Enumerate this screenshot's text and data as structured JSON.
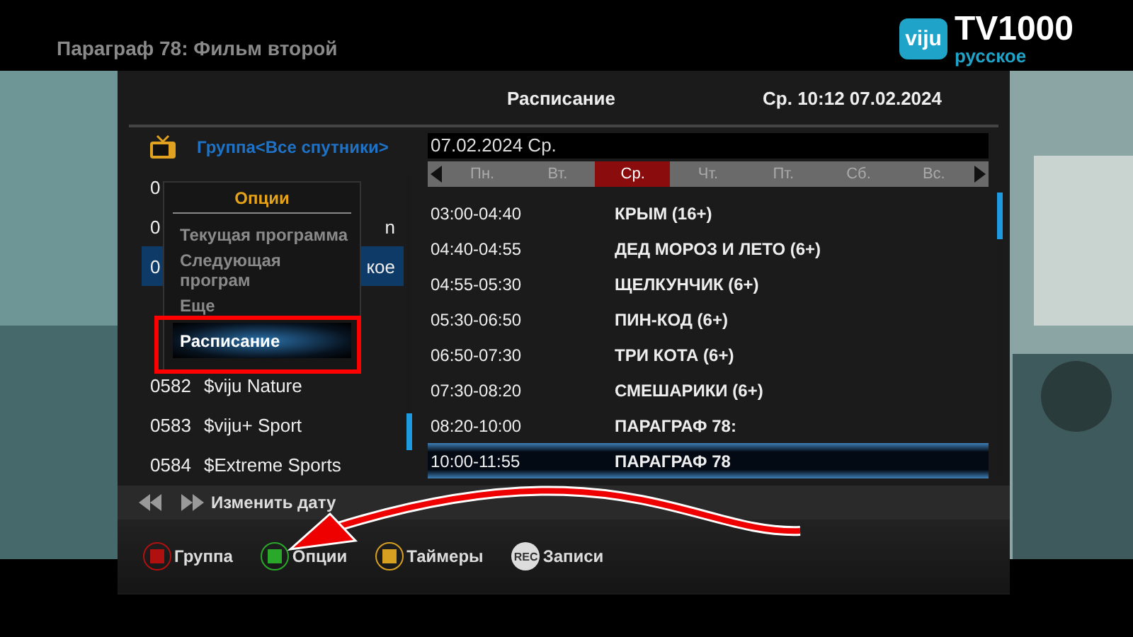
{
  "top_bar": {
    "title": "Параграф 78: Фильм второй",
    "logo": {
      "badge": "viju",
      "name": "TV1000",
      "sub": "русское"
    }
  },
  "header": {
    "title": "Расписание",
    "clock": "Ср. 10:12 07.02.2024"
  },
  "channels": {
    "group": "Группа<Все спутники>",
    "rows": [
      {
        "kind": "covered",
        "number": "0",
        "selected": false
      },
      {
        "kind": "covered",
        "number": "0",
        "tail": "n",
        "selected": false
      },
      {
        "kind": "covered",
        "number": "0",
        "tail": "кое",
        "selected": true
      },
      {
        "kind": "full",
        "number": "0582",
        "name": "$viju Nature",
        "selected": false
      },
      {
        "kind": "full",
        "number": "0583",
        "name": "$viju+ Sport",
        "selected": false
      },
      {
        "kind": "full",
        "number": "0584",
        "name": "$Extreme Sports",
        "selected": false
      }
    ]
  },
  "options_menu": {
    "title": "Опции",
    "items": [
      {
        "label": "Текущая программа",
        "selected": false
      },
      {
        "label": "Следующая програм",
        "selected": false
      },
      {
        "label": "Еще",
        "selected": false
      },
      {
        "label": "Расписание",
        "selected": true
      }
    ]
  },
  "schedule": {
    "date": "07.02.2024 Ср.",
    "days": [
      {
        "label": "Пн.",
        "selected": false
      },
      {
        "label": "Вт.",
        "selected": false
      },
      {
        "label": "Ср.",
        "selected": true
      },
      {
        "label": "Чт.",
        "selected": false
      },
      {
        "label": "Пт.",
        "selected": false
      },
      {
        "label": "Сб.",
        "selected": false
      },
      {
        "label": "Вс.",
        "selected": false
      }
    ],
    "rows": [
      {
        "time": "03:00-04:40",
        "title": "КРЫМ (16+)",
        "selected": false
      },
      {
        "time": "04:40-04:55",
        "title": "ДЕД МОРОЗ И ЛЕТО (6+)",
        "selected": false
      },
      {
        "time": "04:55-05:30",
        "title": "ЩЕЛКУНЧИК (6+)",
        "selected": false
      },
      {
        "time": "05:30-06:50",
        "title": "ПИН-КОД (6+)",
        "selected": false
      },
      {
        "time": "06:50-07:30",
        "title": "ТРИ КОТА (6+)",
        "selected": false
      },
      {
        "time": "07:30-08:20",
        "title": "СМЕШАРИКИ (6+)",
        "selected": false
      },
      {
        "time": "08:20-10:00",
        "title": "ПАРАГРАФ 78:",
        "selected": false
      },
      {
        "time": "10:00-11:55",
        "title": "ПАРАГРАФ 78",
        "selected": true
      }
    ]
  },
  "hint": "Изменить дату",
  "buttons": [
    {
      "kind": "red",
      "label": "Группа"
    },
    {
      "kind": "green",
      "label": "Опции"
    },
    {
      "kind": "yellow",
      "label": "Таймеры"
    },
    {
      "kind": "rec",
      "badge": "REC",
      "label": "Записи"
    }
  ]
}
